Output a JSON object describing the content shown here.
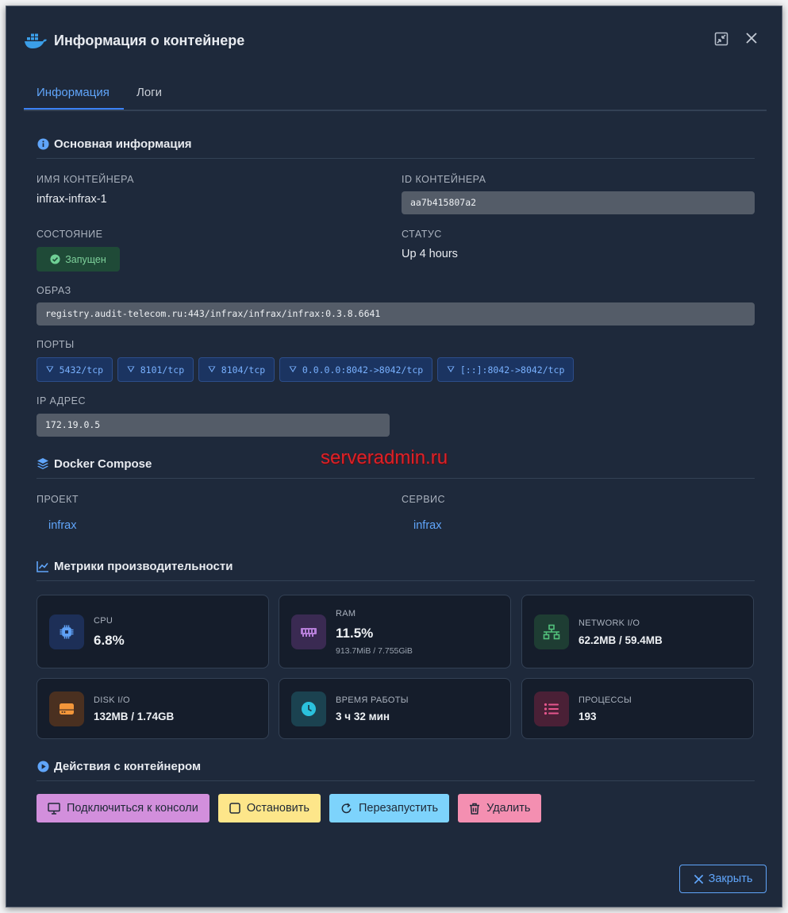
{
  "header": {
    "title": "Информация о контейнере",
    "docker_icon": "docker-whale-icon",
    "minimize_icon": "compress-icon",
    "close_icon": "close-icon"
  },
  "tabs": [
    {
      "label": "Информация",
      "active": true
    },
    {
      "label": "Логи",
      "active": false
    }
  ],
  "basic": {
    "title": "Основная информация",
    "container_name_label": "Имя контейнера",
    "container_name": "infrax-infrax-1",
    "container_id_label": "ID контейнера",
    "container_id": "aa7b415807a2",
    "state_label": "Состояние",
    "state": "Запущен",
    "status_label": "Статус",
    "status": "Up 4 hours",
    "image_label": "Образ",
    "image": "registry.audit-telecom.ru:443/infrax/infrax/infrax:0.3.8.6641",
    "ports_label": "Порты",
    "ports": [
      "5432/tcp",
      "8101/tcp",
      "8104/tcp",
      "0.0.0.0:8042->8042/tcp",
      "[::]:8042->8042/tcp"
    ],
    "ip_label": "IP адрес",
    "ip": "172.19.0.5"
  },
  "compose": {
    "title": "Docker Compose",
    "project_label": "Проект",
    "project": "infrax",
    "service_label": "Сервис",
    "service": "infrax"
  },
  "metrics": {
    "title": "Метрики производительности",
    "cpu": {
      "label": "CPU",
      "value": "6.8%"
    },
    "ram": {
      "label": "RAM",
      "value": "11.5%",
      "sub": "913.7MiB / 7.755GiB"
    },
    "network": {
      "label": "Network I/O",
      "value": "62.2MB / 59.4MB"
    },
    "disk": {
      "label": "Disk I/O",
      "value": "132MB / 1.74GB"
    },
    "uptime": {
      "label": "Время работы",
      "value": "3 ч 32 мин"
    },
    "processes": {
      "label": "Процессы",
      "value": "193"
    }
  },
  "actions": {
    "title": "Действия с контейнером",
    "console": "Подключиться к консоли",
    "stop": "Остановить",
    "restart": "Перезапустить",
    "delete": "Удалить"
  },
  "footer": {
    "close": "Закрыть"
  },
  "watermark": "serveradmin.ru",
  "colors": {
    "background": "#1e293b",
    "accent": "#60a5fa",
    "running_badge": "#1f4a37",
    "console_btn": "#d28fdc",
    "stop_btn": "#fde68a",
    "restart_btn": "#7dd3fc",
    "delete_btn": "#f48fb1"
  }
}
